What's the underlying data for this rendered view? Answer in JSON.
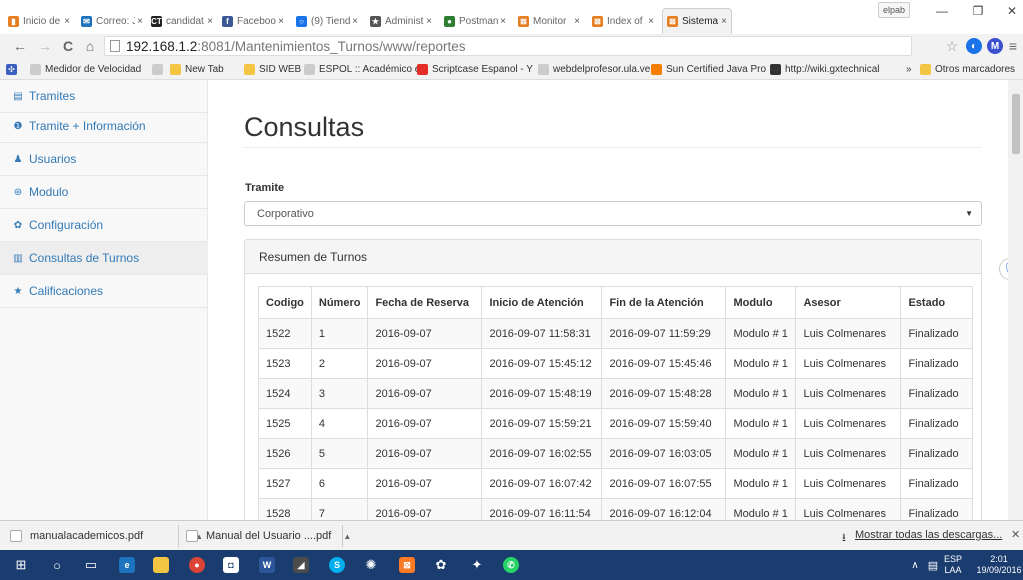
{
  "browser": {
    "tabs": [
      {
        "label": "Inicio de",
        "color": "#e67e22",
        "glyph": "▮"
      },
      {
        "label": "Correo: J",
        "color": "#1e73be",
        "glyph": "✉"
      },
      {
        "label": "candidat",
        "color": "#222222",
        "glyph": "CT"
      },
      {
        "label": "Faceboo",
        "color": "#3b5998",
        "glyph": "f"
      },
      {
        "label": "(9) Tiend",
        "color": "#1a73e8",
        "glyph": "○"
      },
      {
        "label": "Administ",
        "color": "#555555",
        "glyph": "★"
      },
      {
        "label": "Postman",
        "color": "#2e7d32",
        "glyph": "●"
      },
      {
        "label": "Monitor",
        "color": "#e67e22",
        "glyph": "⊠"
      },
      {
        "label": "Index of",
        "color": "#e67e22",
        "glyph": "⊠"
      },
      {
        "label": "Sistema",
        "color": "#e67e22",
        "glyph": "⊠"
      }
    ],
    "profile_name": "elpab",
    "url_host": "192.168.1.2",
    "url_path": ":8081/Mantenimientos_Turnos/www/reportes",
    "bookmarks": [
      {
        "label": "Medidor de Velocidad",
        "color": "#cccccc"
      },
      {
        "label": "",
        "color": "#cccccc"
      },
      {
        "label": "New Tab",
        "color": "#f4c542"
      },
      {
        "label": "SID WEB",
        "color": "#f4c542"
      },
      {
        "label": "ESPOL :: Académico e",
        "color": "#cccccc"
      },
      {
        "label": "Scriptcase Espanol - Y",
        "color": "#e52d27"
      },
      {
        "label": "webdelprofesor.ula.ve",
        "color": "#cccccc"
      },
      {
        "label": "Sun Certified Java Pro",
        "color": "#f57d00"
      },
      {
        "label": "http://wiki.gxtechnical",
        "color": "#333333"
      }
    ],
    "bookmarks_overflow": "»",
    "other_bookmarks": "Otros marcadores"
  },
  "sidebar": {
    "items": [
      {
        "label": "Tramites",
        "icon": "▤"
      },
      {
        "label": "Tramite + Información",
        "icon": "❶"
      },
      {
        "label": "Usuarios",
        "icon": "♟"
      },
      {
        "label": "Modulo",
        "icon": "⊛"
      },
      {
        "label": "Configuración",
        "icon": "✿"
      },
      {
        "label": "Consultas de Turnos",
        "icon": "▥"
      },
      {
        "label": "Calificaciones",
        "icon": "★"
      }
    ]
  },
  "main": {
    "title": "Consultas",
    "tramite_label": "Tramite",
    "tramite_value": "Corporativo",
    "panel_heading": "Resumen de Turnos",
    "table": {
      "headers": [
        "Codigo",
        "Número",
        "Fecha de Reserva",
        "Inicio de Atención",
        "Fin de la Atención",
        "Modulo",
        "Asesor",
        "Estado"
      ],
      "rows": [
        [
          "1522",
          "1",
          "2016-09-07",
          "2016-09-07 11:58:31",
          "2016-09-07 11:59:29",
          "Modulo # 1",
          "Luis Colmenares",
          "Finalizado"
        ],
        [
          "1523",
          "2",
          "2016-09-07",
          "2016-09-07 15:45:12",
          "2016-09-07 15:45:46",
          "Modulo # 1",
          "Luis Colmenares",
          "Finalizado"
        ],
        [
          "1524",
          "3",
          "2016-09-07",
          "2016-09-07 15:48:19",
          "2016-09-07 15:48:28",
          "Modulo # 1",
          "Luis Colmenares",
          "Finalizado"
        ],
        [
          "1525",
          "4",
          "2016-09-07",
          "2016-09-07 15:59:21",
          "2016-09-07 15:59:40",
          "Modulo # 1",
          "Luis Colmenares",
          "Finalizado"
        ],
        [
          "1526",
          "5",
          "2016-09-07",
          "2016-09-07 16:02:55",
          "2016-09-07 16:03:05",
          "Modulo # 1",
          "Luis Colmenares",
          "Finalizado"
        ],
        [
          "1527",
          "6",
          "2016-09-07",
          "2016-09-07 16:07:42",
          "2016-09-07 16:07:55",
          "Modulo # 1",
          "Luis Colmenares",
          "Finalizado"
        ],
        [
          "1528",
          "7",
          "2016-09-07",
          "2016-09-07 16:11:54",
          "2016-09-07 16:12:04",
          "Modulo # 1",
          "Luis Colmenares",
          "Finalizado"
        ]
      ]
    }
  },
  "downloads": {
    "items": [
      "manualacademicos.pdf",
      "Manual del Usuario ....pdf"
    ],
    "show_all": "Mostrar todas las descargas..."
  },
  "taskbar": {
    "lang_top": "ESP",
    "lang_bottom": "LAA",
    "time": "2:01",
    "date": "19/09/2016"
  },
  "colors": {
    "link": "#337ab7",
    "taskbar": "#1a3c6e"
  }
}
